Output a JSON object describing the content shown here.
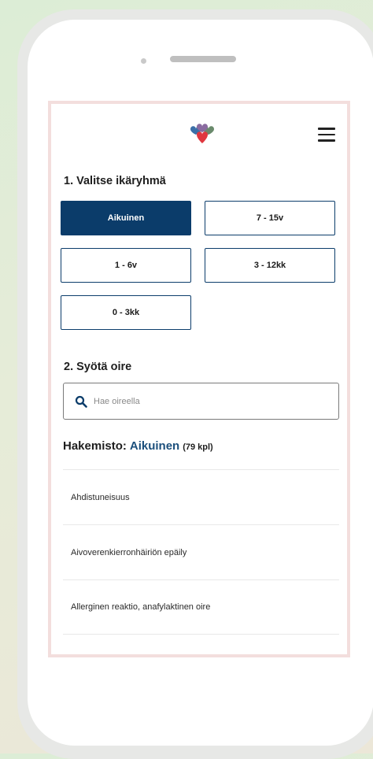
{
  "icons": {
    "logo": "hearts-logo-icon",
    "menu": "hamburger-menu-icon",
    "search": "search-icon"
  },
  "colors": {
    "primary": "#0b3c6a",
    "heading_accent": "#1b4f7c",
    "screen_border": "#f3dedd"
  },
  "step1": {
    "title": "1. Valitse ikäryhmä",
    "age_groups": [
      {
        "label": "Aikuinen",
        "selected": true
      },
      {
        "label": "7 - 15v",
        "selected": false
      },
      {
        "label": "1 - 6v",
        "selected": false
      },
      {
        "label": "3 - 12kk",
        "selected": false
      },
      {
        "label": "0 - 3kk",
        "selected": false
      }
    ]
  },
  "step2": {
    "title": "2. Syötä oire",
    "search_placeholder": "Hae oireella",
    "search_value": ""
  },
  "directory": {
    "label": "Hakemisto:",
    "age_group": "Aikuinen",
    "count": "(79 kpl)",
    "items": [
      "Ahdistuneisuus",
      "Aivoverenkierronhäiriön epäily",
      "Allerginen reaktio, anafylaktinen oire"
    ]
  }
}
